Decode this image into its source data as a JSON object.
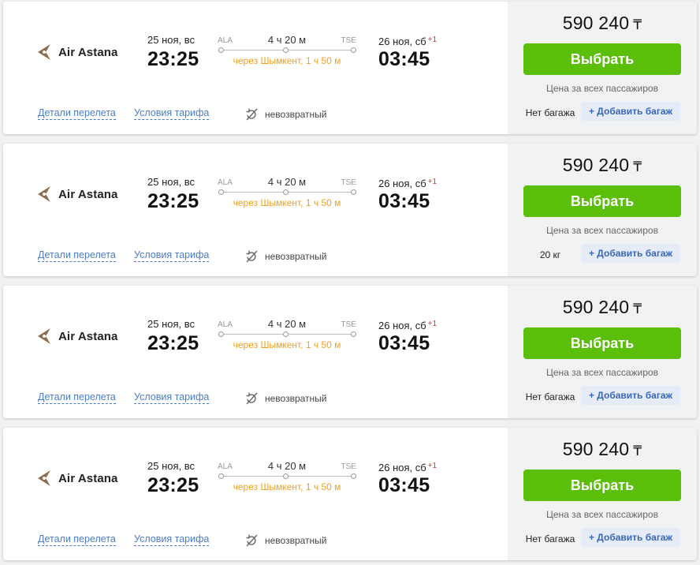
{
  "colors": {
    "buy_button": "#5bbf0a",
    "stopover_text": "#f2a01b",
    "link": "#4a7cc9",
    "next_day_badge": "#e2322d",
    "add_baggage_bg": "#e6ecf7",
    "price_panel_bg": "#f1f2f4",
    "airline_logo": "#8a6d4b"
  },
  "icons": {
    "airline_logo": "air-astana-logo",
    "refund": "non-refundable-icon"
  },
  "flights": [
    {
      "airline": "Air Astana",
      "departure": {
        "date": "25 ноя, вс",
        "time": "23:25",
        "code": "ALA"
      },
      "arrival": {
        "date": "26 ноя, сб",
        "day_offset": "+1",
        "time": "03:45",
        "code": "TSE"
      },
      "duration": "4 ч 20 м",
      "stopover": "через Шымкент, 1 ч 50 м",
      "details_link": "Детали перелета",
      "tariff_link": "Условия тарифа",
      "refund_text": "невозвратный",
      "price": "590 240",
      "currency": "₸",
      "buy_label": "Выбрать",
      "price_note": "Цена за всех пассажиров",
      "baggage": "Нет багажа",
      "add_baggage_label": "+ Добавить багаж"
    },
    {
      "airline": "Air Astana",
      "departure": {
        "date": "25 ноя, вс",
        "time": "23:25",
        "code": "ALA"
      },
      "arrival": {
        "date": "26 ноя, сб",
        "day_offset": "+1",
        "time": "03:45",
        "code": "TSE"
      },
      "duration": "4 ч 20 м",
      "stopover": "через Шымкент, 1 ч 50 м",
      "details_link": "Детали перелета",
      "tariff_link": "Условия тарифа",
      "refund_text": "невозвратный",
      "price": "590 240",
      "currency": "₸",
      "buy_label": "Выбрать",
      "price_note": "Цена за всех пассажиров",
      "baggage": "20 кг",
      "add_baggage_label": "+ Добавить багаж"
    },
    {
      "airline": "Air Astana",
      "departure": {
        "date": "25 ноя, вс",
        "time": "23:25",
        "code": "ALA"
      },
      "arrival": {
        "date": "26 ноя, сб",
        "day_offset": "+1",
        "time": "03:45",
        "code": "TSE"
      },
      "duration": "4 ч 20 м",
      "stopover": "через Шымкент, 1 ч 50 м",
      "details_link": "Детали перелета",
      "tariff_link": "Условия тарифа",
      "refund_text": "невозвратный",
      "price": "590 240",
      "currency": "₸",
      "buy_label": "Выбрать",
      "price_note": "Цена за всех пассажиров",
      "baggage": "Нет багажа",
      "add_baggage_label": "+ Добавить багаж"
    },
    {
      "airline": "Air Astana",
      "departure": {
        "date": "25 ноя, вс",
        "time": "23:25",
        "code": "ALA"
      },
      "arrival": {
        "date": "26 ноя, сб",
        "day_offset": "+1",
        "time": "03:45",
        "code": "TSE"
      },
      "duration": "4 ч 20 м",
      "stopover": "через Шымкент, 1 ч 50 м",
      "details_link": "Детали перелета",
      "tariff_link": "Условия тарифа",
      "refund_text": "невозвратный",
      "price": "590 240",
      "currency": "₸",
      "buy_label": "Выбрать",
      "price_note": "Цена за всех пассажиров",
      "baggage": "Нет багажа",
      "add_baggage_label": "+ Добавить багаж"
    }
  ]
}
